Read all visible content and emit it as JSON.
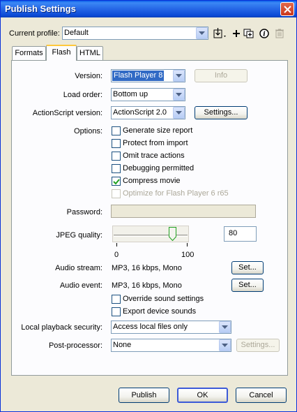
{
  "window": {
    "title": "Publish Settings"
  },
  "profile": {
    "label": "Current profile:",
    "value": "Default"
  },
  "tabs": [
    {
      "label": "Formats",
      "active": false
    },
    {
      "label": "Flash",
      "active": true
    },
    {
      "label": "HTML",
      "active": false
    }
  ],
  "version": {
    "label": "Version:",
    "value": "Flash Player 8",
    "info_button": "Info"
  },
  "load_order": {
    "label": "Load order:",
    "value": "Bottom up"
  },
  "actionscript": {
    "label": "ActionScript version:",
    "value": "ActionScript 2.0",
    "settings_button": "Settings..."
  },
  "options": {
    "label": "Options:",
    "items": [
      {
        "label": "Generate size report",
        "checked": false,
        "enabled": true
      },
      {
        "label": "Protect from import",
        "checked": false,
        "enabled": true
      },
      {
        "label": "Omit trace actions",
        "checked": false,
        "enabled": true
      },
      {
        "label": "Debugging permitted",
        "checked": false,
        "enabled": true
      },
      {
        "label": "Compress movie",
        "checked": true,
        "enabled": true
      },
      {
        "label": "Optimize for Flash Player 6 r65",
        "checked": false,
        "enabled": false
      }
    ]
  },
  "password": {
    "label": "Password:",
    "value": ""
  },
  "jpeg": {
    "label": "JPEG quality:",
    "value": "80",
    "slider_fraction": 0.8,
    "min_label": "0",
    "max_label": "100"
  },
  "audio_stream": {
    "label": "Audio stream:",
    "value": "MP3, 16 kbps, Mono",
    "button": "Set..."
  },
  "audio_event": {
    "label": "Audio event:",
    "value": "MP3, 16 kbps, Mono",
    "button": "Set..."
  },
  "sound_options": [
    {
      "label": "Override sound settings",
      "checked": false
    },
    {
      "label": "Export device sounds",
      "checked": false
    }
  ],
  "local_playback": {
    "label": "Local playback security:",
    "value": "Access local files only"
  },
  "post_processor": {
    "label": "Post-processor:",
    "value": "None",
    "settings_button": "Settings..."
  },
  "footer": {
    "publish": "Publish",
    "ok": "OK",
    "cancel": "Cancel"
  },
  "colors": {
    "titlebar": "#0a5fe8",
    "selection": "#316ac5",
    "dialog_bg": "#ece9d8"
  }
}
